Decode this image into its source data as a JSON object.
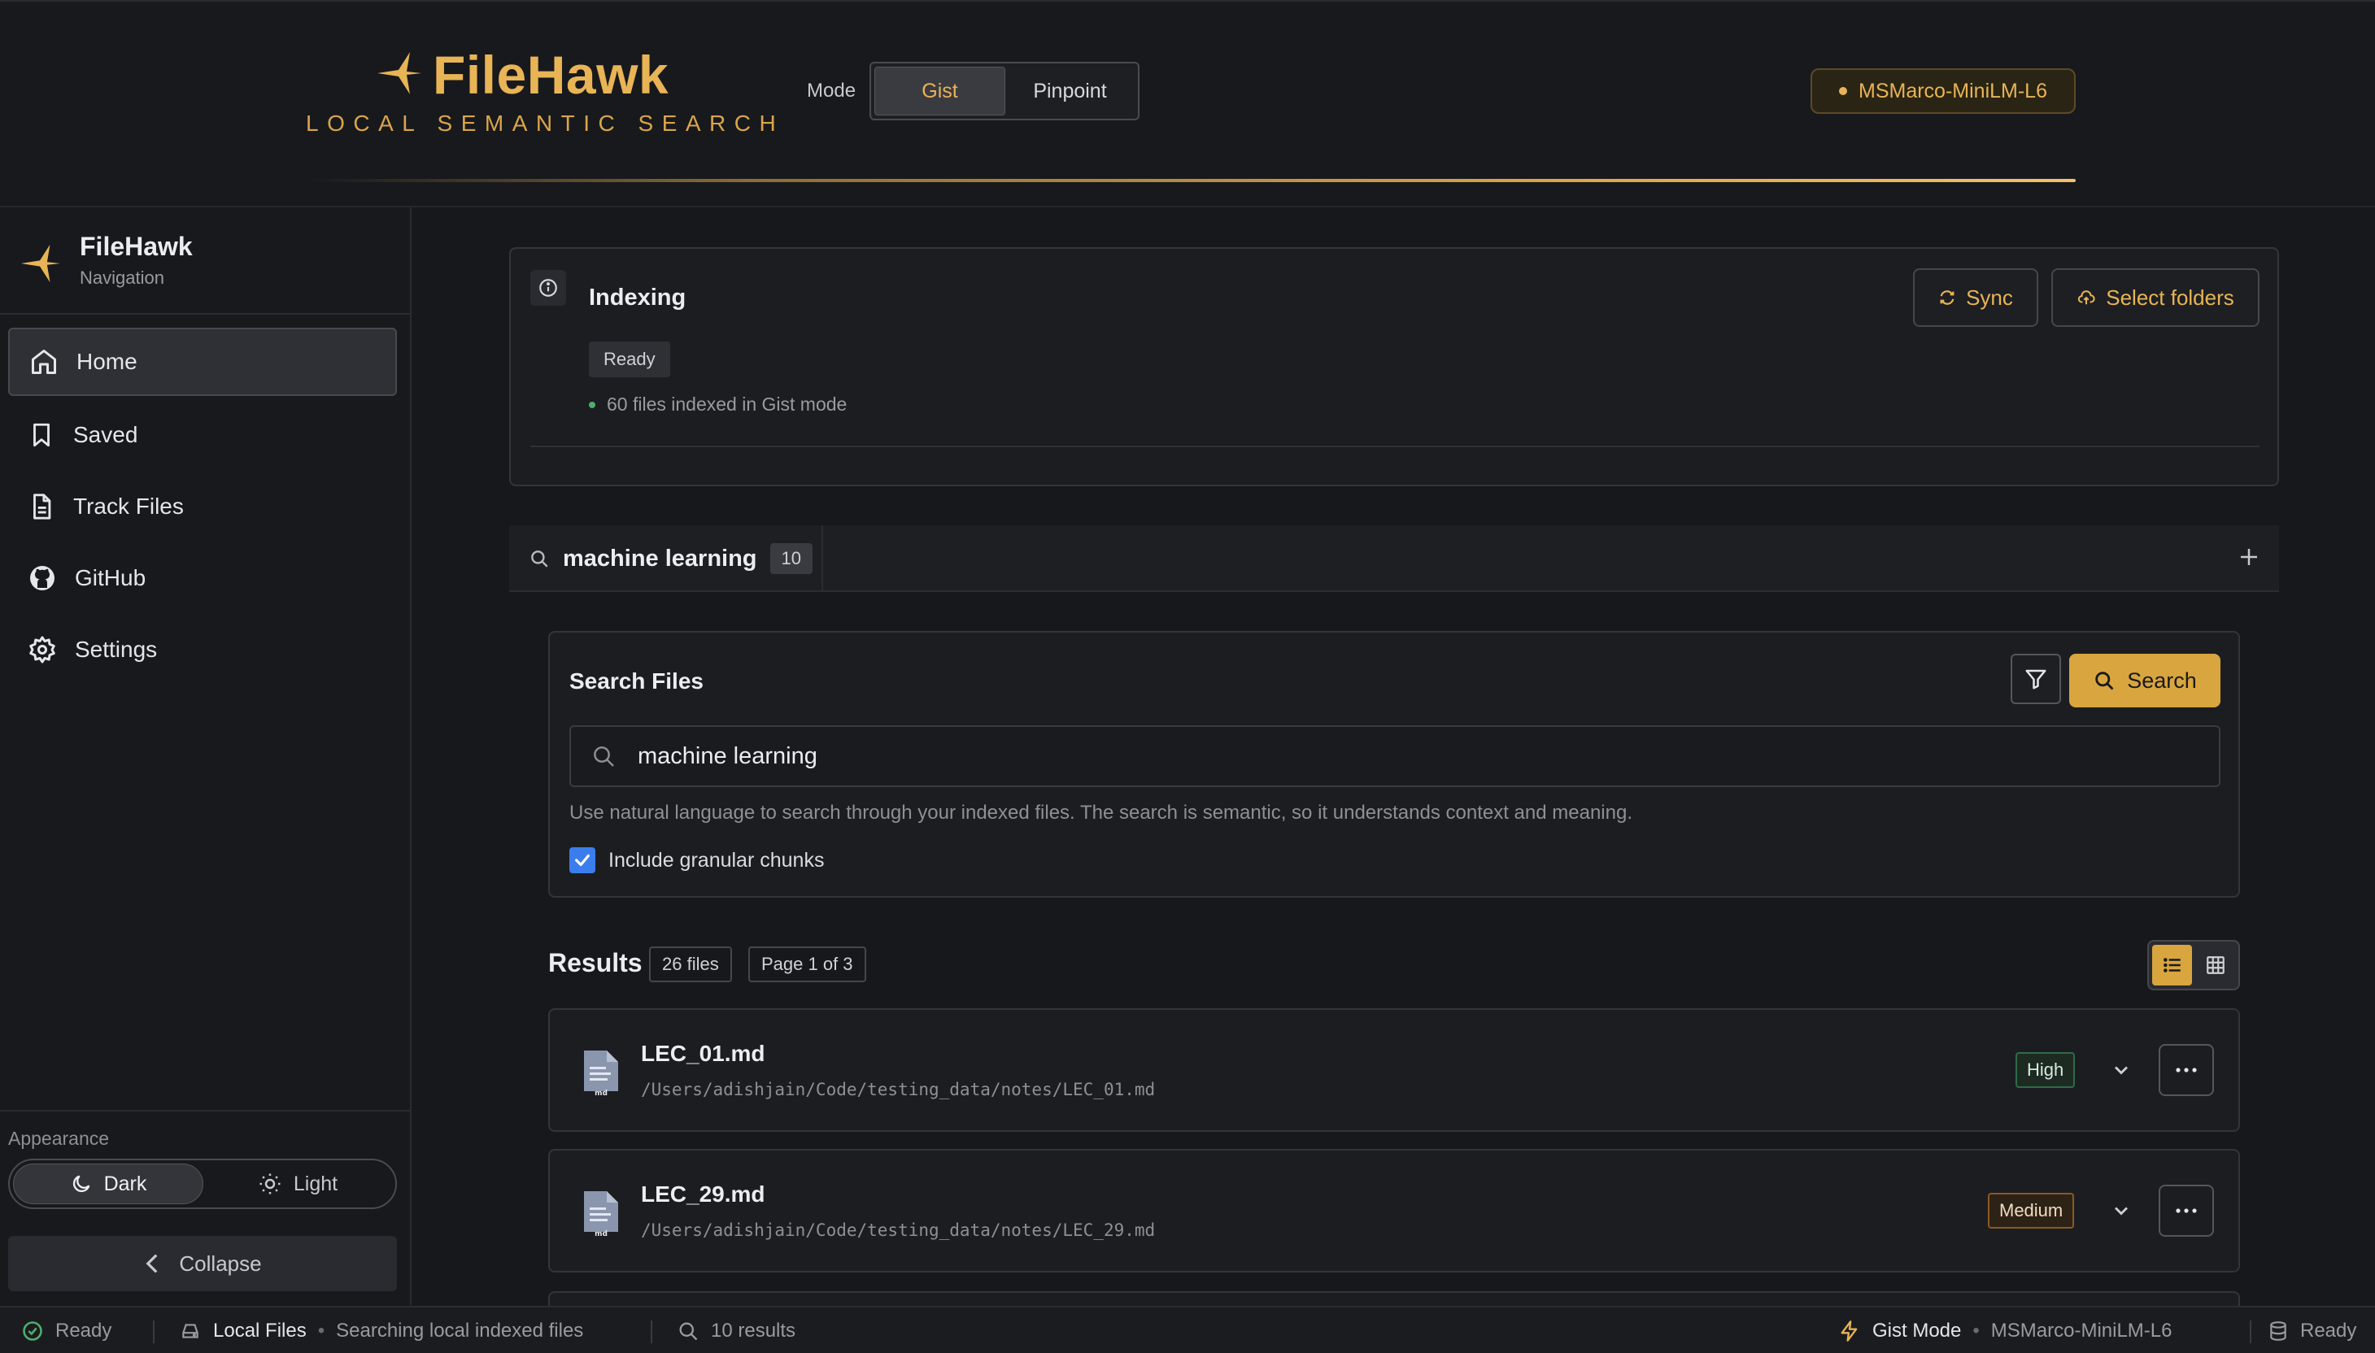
{
  "header": {
    "brand_title": "FileHawk",
    "brand_subtitle": "LOCAL SEMANTIC SEARCH",
    "mode_label": "Mode",
    "modes": [
      "Gist",
      "Pinpoint"
    ],
    "active_mode": "Gist",
    "model_name": "MSMarco-MiniLM-L6",
    "accent_color": "#e8b455"
  },
  "sidebar": {
    "brand_title": "FileHawk",
    "brand_subtitle": "Navigation",
    "items": [
      {
        "label": "Home",
        "icon": "home-icon",
        "active": true
      },
      {
        "label": "Saved",
        "icon": "bookmark-icon"
      },
      {
        "label": "Track Files",
        "icon": "file-icon"
      },
      {
        "label": "GitHub",
        "icon": "github-icon"
      },
      {
        "label": "Settings",
        "icon": "gear-icon"
      }
    ],
    "appearance_label": "Appearance",
    "theme_dark": "Dark",
    "theme_light": "Light",
    "collapse_label": "Collapse"
  },
  "indexing": {
    "title": "Indexing",
    "status": "Ready",
    "detail": "60 files indexed in Gist mode",
    "sync_label": "Sync",
    "select_label": "Select folders"
  },
  "search_tab": {
    "query": "machine learning",
    "count": "10"
  },
  "search": {
    "title": "Search Files",
    "button_label": "Search",
    "query": "machine learning",
    "help": "Use natural language to search through your indexed files. The search is semantic, so it understands context and meaning.",
    "granular_label": "Include granular chunks",
    "granular_checked": true
  },
  "results": {
    "title": "Results",
    "files_chip": "26 files",
    "page_chip": "Page 1 of 3",
    "items": [
      {
        "name": "LEC_01.md",
        "path": "/Users/adishjain/Code/testing_data/notes/LEC_01.md",
        "relevance": "High",
        "ext": "md"
      },
      {
        "name": "LEC_29.md",
        "path": "/Users/adishjain/Code/testing_data/notes/LEC_29.md",
        "relevance": "Medium",
        "ext": "md"
      }
    ]
  },
  "status": {
    "ready": "Ready",
    "source": "Local Files",
    "source_detail": "Searching local indexed files",
    "results": "10 results",
    "mode": "Gist Mode",
    "model": "MSMarco-MiniLM-L6",
    "right_ready": "Ready"
  }
}
